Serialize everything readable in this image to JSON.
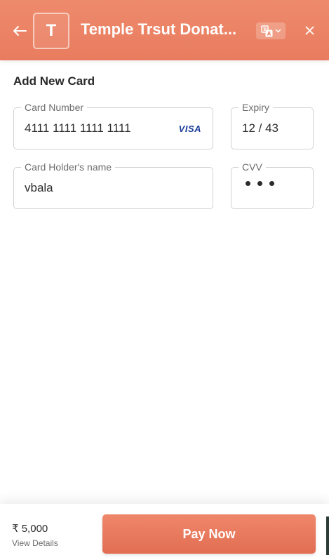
{
  "header": {
    "logo_letter": "T",
    "title": "Temple Trsut Donat...",
    "icons": {
      "back": "arrow-left-icon",
      "language": "translate-icon",
      "language_chevron": "chevron-down-icon",
      "close": "close-icon"
    },
    "colors": {
      "background": "#e97c5f",
      "text": "#ffffff"
    }
  },
  "form": {
    "title": "Add New Card",
    "card_number": {
      "label": "Card Number",
      "value": "4111 1111 1111 1111",
      "network": "VISA"
    },
    "expiry": {
      "label": "Expiry",
      "value": "12 / 43"
    },
    "holder_name": {
      "label": "Card Holder's name",
      "value": "vbala"
    },
    "cvv": {
      "label": "CVV",
      "masked_length": 3
    }
  },
  "footer": {
    "amount": "₹ 5,000",
    "view_details": "View Details",
    "pay_button": "Pay Now",
    "colors": {
      "button": "#e97c5f"
    }
  }
}
